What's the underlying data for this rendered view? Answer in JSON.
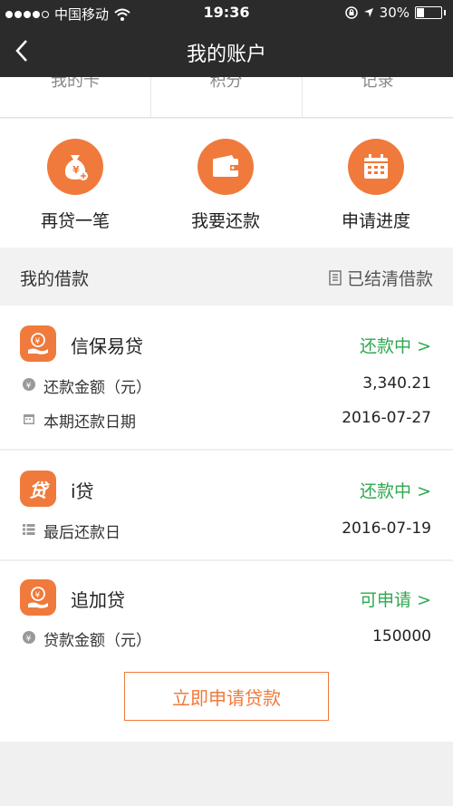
{
  "status_bar": {
    "carrier": "中国移动",
    "time": "19:36",
    "battery_percent": "30%",
    "battery_level": 0.3
  },
  "nav": {
    "back_icon": "chevron-left-icon",
    "title": "我的账户"
  },
  "peek_tabs": [
    "我的卡",
    "积分",
    "记录"
  ],
  "actions": [
    {
      "label": "再贷一笔",
      "icon": "money-bag-icon"
    },
    {
      "label": "我要还款",
      "icon": "wallet-icon"
    },
    {
      "label": "申请进度",
      "icon": "calendar-icon"
    }
  ],
  "section": {
    "title": "我的借款",
    "settled_label": "已结清借款"
  },
  "loans": [
    {
      "name": "信保易贷",
      "status": "还款中 >",
      "rows": [
        {
          "label": "还款金额（元）",
          "value": "3,340.21",
          "icon": "yen-icon"
        },
        {
          "label": "本期还款日期",
          "value": "2016-07-27",
          "icon": "calendar-small-icon"
        }
      ]
    },
    {
      "name": "i贷",
      "status": "还款中 >",
      "rows": [
        {
          "label": "最后还款日",
          "value": "2016-07-19",
          "icon": "list-icon"
        }
      ]
    },
    {
      "name": "追加贷",
      "status": "可申请 >",
      "rows": [
        {
          "label": "贷款金额（元）",
          "value": "150000",
          "icon": "yen-icon"
        }
      ]
    }
  ],
  "apply_button": "立即申请贷款",
  "colors": {
    "accent": "#ef7a3c",
    "status_green": "#2fa84f",
    "header_bg": "#2b2b2b"
  }
}
